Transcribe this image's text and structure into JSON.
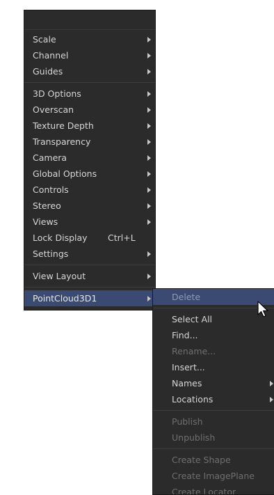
{
  "main_menu": {
    "groups": [
      [
        {
          "label": "Scale",
          "submenu": true
        },
        {
          "label": "Channel",
          "submenu": true
        },
        {
          "label": "Guides",
          "submenu": true
        }
      ],
      [
        {
          "label": "3D Options",
          "submenu": true
        },
        {
          "label": "Overscan",
          "submenu": true
        },
        {
          "label": "Texture Depth",
          "submenu": true
        },
        {
          "label": "Transparency",
          "submenu": true
        },
        {
          "label": "Camera",
          "submenu": true
        },
        {
          "label": "Global Options",
          "submenu": true
        },
        {
          "label": "Controls",
          "submenu": true
        },
        {
          "label": "Stereo",
          "submenu": true
        },
        {
          "label": "Views",
          "submenu": true
        },
        {
          "label": "Lock Display",
          "shortcut": "Ctrl+L"
        },
        {
          "label": "Settings",
          "submenu": true
        }
      ],
      [
        {
          "label": "View Layout",
          "submenu": true
        }
      ],
      [
        {
          "label": "PointCloud3D1",
          "submenu": true,
          "highlighted": true
        }
      ]
    ]
  },
  "sub_menu": {
    "groups": [
      [
        {
          "label": "Delete",
          "highlighted": true
        }
      ],
      [
        {
          "label": "Select All"
        },
        {
          "label": "Find..."
        },
        {
          "label": "Rename...",
          "disabled": true
        },
        {
          "label": "Insert..."
        },
        {
          "label": "Names",
          "submenu": true
        },
        {
          "label": "Locations",
          "submenu": true
        }
      ],
      [
        {
          "label": "Publish",
          "disabled": true
        },
        {
          "label": "Unpublish",
          "disabled": true
        }
      ],
      [
        {
          "label": "Create Shape",
          "disabled": true
        },
        {
          "label": "Create ImagePlane",
          "disabled": true
        },
        {
          "label": "Create Locator",
          "disabled": true
        }
      ]
    ]
  },
  "colors": {
    "menu_bg": "#2b2b2b",
    "highlight": "#3a4a73",
    "text": "#d6d6d6",
    "disabled_text": "#6f6f6f"
  },
  "icons": {
    "cursor": "mouse-pointer-icon",
    "submenu": "triangle-right-icon"
  }
}
